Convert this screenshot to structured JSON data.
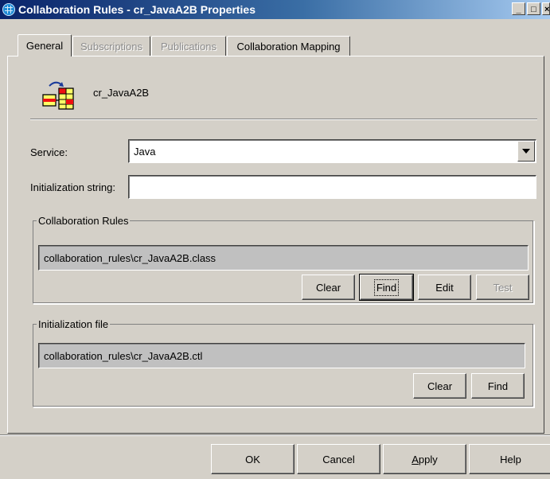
{
  "window": {
    "title": "Collaboration Rules - cr_JavaA2B Properties",
    "minimize_glyph": "_",
    "maximize_glyph": "□",
    "close_glyph": "×"
  },
  "tabs": [
    {
      "label": "General",
      "active": true,
      "enabled": true
    },
    {
      "label": "Subscriptions",
      "active": false,
      "enabled": false
    },
    {
      "label": "Publications",
      "active": false,
      "enabled": false
    },
    {
      "label": "Collaboration Mapping",
      "active": false,
      "enabled": true
    }
  ],
  "general": {
    "object_name": "cr_JavaA2B",
    "service_label": "Service:",
    "service_value": "Java",
    "init_string_label": "Initialization string:",
    "init_string_value": "",
    "collab_rules": {
      "legend": "Collaboration Rules",
      "path": "collaboration_rules\\cr_JavaA2B.class",
      "buttons": {
        "clear": "Clear",
        "find": "Find",
        "edit": "Edit",
        "test": "Test"
      }
    },
    "init_file": {
      "legend": "Initialization file",
      "path": "collaboration_rules\\cr_JavaA2B.ctl",
      "buttons": {
        "clear": "Clear",
        "find": "Find"
      }
    }
  },
  "footer": {
    "ok": "OK",
    "cancel": "Cancel",
    "apply_rest": "pply",
    "apply_accel": "A",
    "help": "Help"
  },
  "colors": {
    "face": "#d4d0c8",
    "title_start": "#0a246a",
    "title_end": "#a6caf0"
  }
}
